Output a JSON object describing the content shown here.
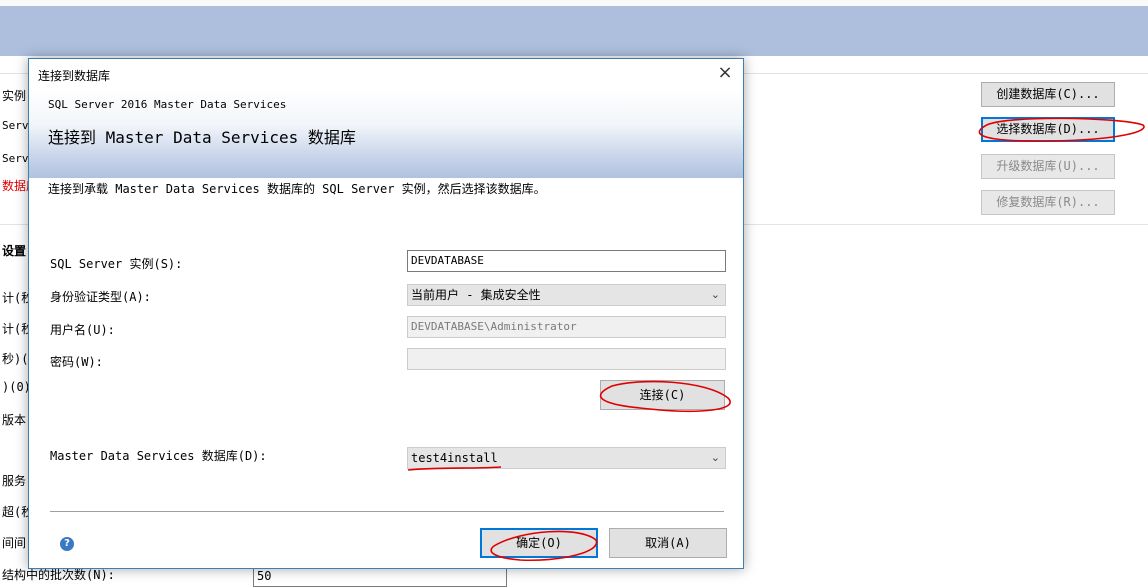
{
  "background": {
    "fragments": [
      "实例:",
      "Serv",
      "Serv",
      "数据库",
      "设置",
      "计(秒",
      "计(秒",
      "秒)(",
      ")(0)",
      "版本(",
      "服务(",
      "超(秒",
      "间间",
      "结构中的批次数(N):"
    ],
    "right_buttons": [
      {
        "label": "创建数据库(C)..."
      },
      {
        "label": "选择数据库(D)..."
      },
      {
        "label": "升级数据库(U)..."
      },
      {
        "label": "修复数据库(R)..."
      }
    ],
    "batch_input": "50"
  },
  "dialog": {
    "title": "连接到数据库",
    "close_glyph": "×",
    "banner_sub": "SQL Server 2016 Master Data Services",
    "banner_heading": "连接到 Master Data Services 数据库",
    "description": "连接到承载 Master Data Services 数据库的 SQL Server 实例，然后选择该数据库。",
    "instance_label": "SQL Server 实例(S):",
    "instance_value": "DEVDATABASE",
    "auth_label": "身份验证类型(A):",
    "auth_value": "当前用户 - 集成安全性",
    "user_label": "用户名(U):",
    "user_value": "DEVDATABASE\\Administrator",
    "password_label": "密码(W):",
    "password_value": "",
    "connect_label": "连接(C)",
    "db_label": "Master Data Services 数据库(D):",
    "db_value": "test4install",
    "ok_label": "确定(O)",
    "cancel_label": "取消(A)",
    "help_glyph": "?"
  },
  "colors": {
    "annotation": "#e00000",
    "accent": "#0078d7",
    "banner": "#adbfdd"
  }
}
